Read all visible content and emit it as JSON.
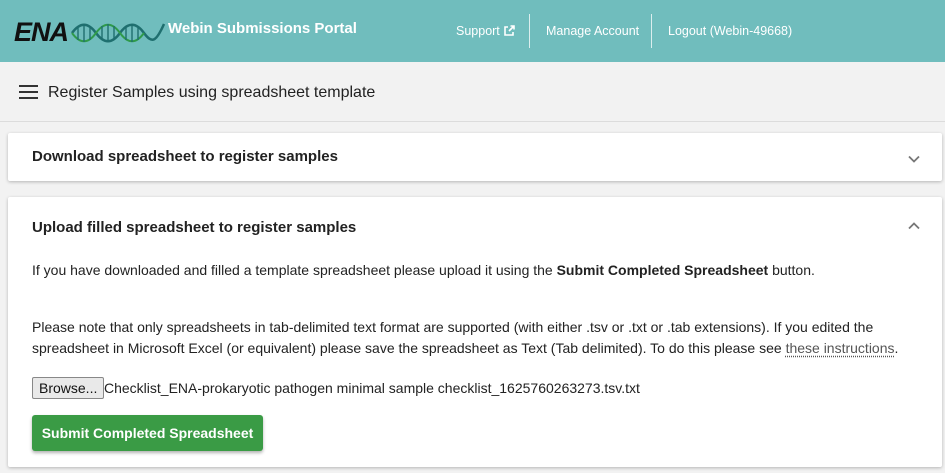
{
  "header": {
    "logo_text": "ENA",
    "portal_title": "Webin Submissions Portal",
    "nav": {
      "support": "Support",
      "manage_account": "Manage Account",
      "logout": "Logout (Webin-49668)"
    },
    "icons": {
      "support": "external-link-icon",
      "logo": "dna-helix-icon"
    },
    "colors": {
      "header_bg": "#70bdbd"
    }
  },
  "subbar": {
    "menu_icon": "hamburger-menu-icon",
    "title": "Register Samples using spreadsheet template"
  },
  "panels": {
    "download": {
      "heading": "Download spreadsheet to register samples",
      "state": "collapsed",
      "icon": "chevron-down-icon"
    },
    "upload": {
      "heading": "Upload filled spreadsheet to register samples",
      "state": "expanded",
      "icon": "chevron-up-icon",
      "para1_before": "If you have downloaded and filled a template spreadsheet please upload it using the ",
      "para1_bold": "Submit Completed Spreadsheet",
      "para1_after": " button.",
      "para2_text": "Please note that only spreadsheets in tab-delimited text format are supported (with either .tsv or .txt or .tab extensions). If you edited the spreadsheet in Microsoft Excel (or equivalent) please save the spreadsheet as Text (Tab delimited). To do this please see ",
      "para2_link": "these instructions",
      "para2_end": ".",
      "browse_label": "Browse...",
      "file_name": "Checklist_ENA-prokaryotic pathogen minimal sample checklist_1625760263273.tsv.txt",
      "submit_label": "Submit Completed Spreadsheet",
      "submit_color": "#3a9b45"
    }
  }
}
